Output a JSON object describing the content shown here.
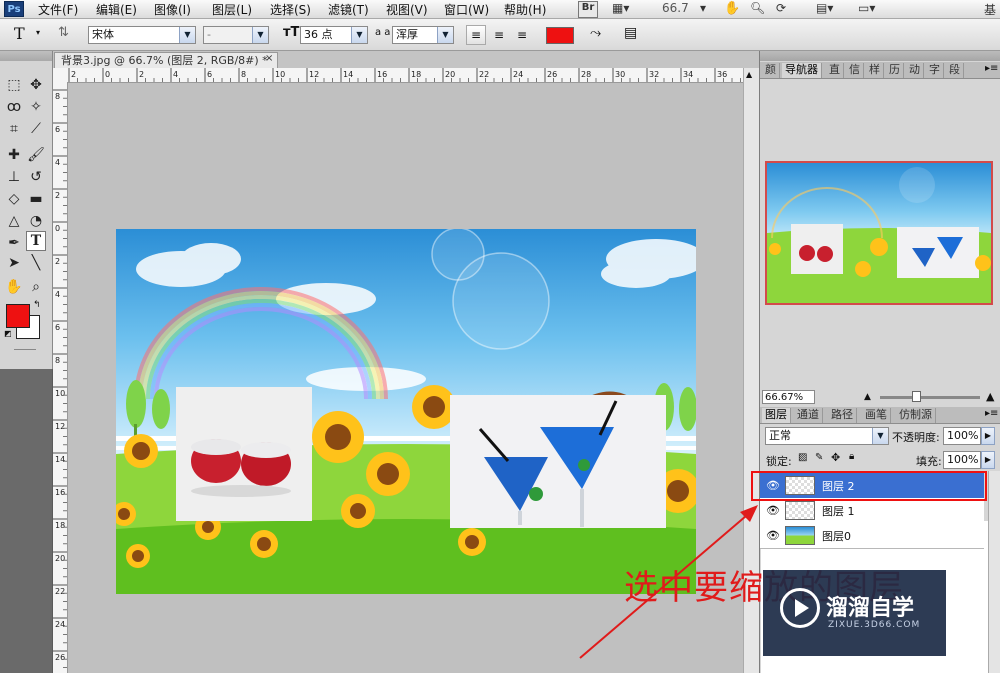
{
  "app": {
    "logo": "Ps",
    "menu": [
      "文件(F)",
      "编辑(E)",
      "图像(I)",
      "图层(L)",
      "选择(S)",
      "滤镜(T)",
      "视图(V)",
      "窗口(W)",
      "帮助(H)"
    ],
    "bridge_button": "Br",
    "zoom_level": "66.7",
    "workspace_label": "基"
  },
  "options_bar": {
    "tool_icon": "T",
    "font_family": "宋体",
    "font_style": "-",
    "font_size": "36 点",
    "aa_label": "a a",
    "antialias": "浑厚",
    "text_color": "#ee1111"
  },
  "document": {
    "tab_title": "背景3.jpg @ 66.7% (图层 2, RGB/8#) *",
    "close_glyph": "×",
    "ruler_h_labels": [
      "2",
      "0",
      "2",
      "4",
      "6",
      "8",
      "10",
      "12",
      "14",
      "16",
      "18",
      "20",
      "22",
      "24",
      "26",
      "28",
      "30",
      "32",
      "34",
      "36"
    ],
    "ruler_v_labels": [
      "8",
      "6",
      "4",
      "2",
      "0",
      "2",
      "4",
      "6",
      "8",
      "10",
      "12",
      "14",
      "16",
      "18",
      "20",
      "22",
      "24",
      "26"
    ]
  },
  "panels": {
    "top_tabs": [
      "颜",
      "导航器",
      "直",
      "信",
      "样",
      "历",
      "动",
      "字",
      "段"
    ],
    "navigator_zoom": "66.67%",
    "layers_tabs": [
      "图层",
      "通道",
      "路径",
      "画笔",
      "仿制源"
    ],
    "blend_mode": "正常",
    "opacity_label": "不透明度:",
    "opacity_value": "100%",
    "lock_label": "锁定:",
    "fill_label": "填充:",
    "fill_value": "100%",
    "layers": [
      {
        "name": "图层 2",
        "selected": true
      },
      {
        "name": "图层 1",
        "selected": false
      },
      {
        "name": "图层0",
        "selected": false
      }
    ]
  },
  "annotation": {
    "text": "选中要缩放的图层",
    "color": "#e01b1b"
  },
  "watermark": {
    "title": "溜溜自学",
    "subtitle": "ZIXUE.3D66.COM"
  },
  "colors": {
    "foreground": "#ee1111",
    "background": "#ffffff",
    "selected_layer": "#3a6fd1"
  }
}
